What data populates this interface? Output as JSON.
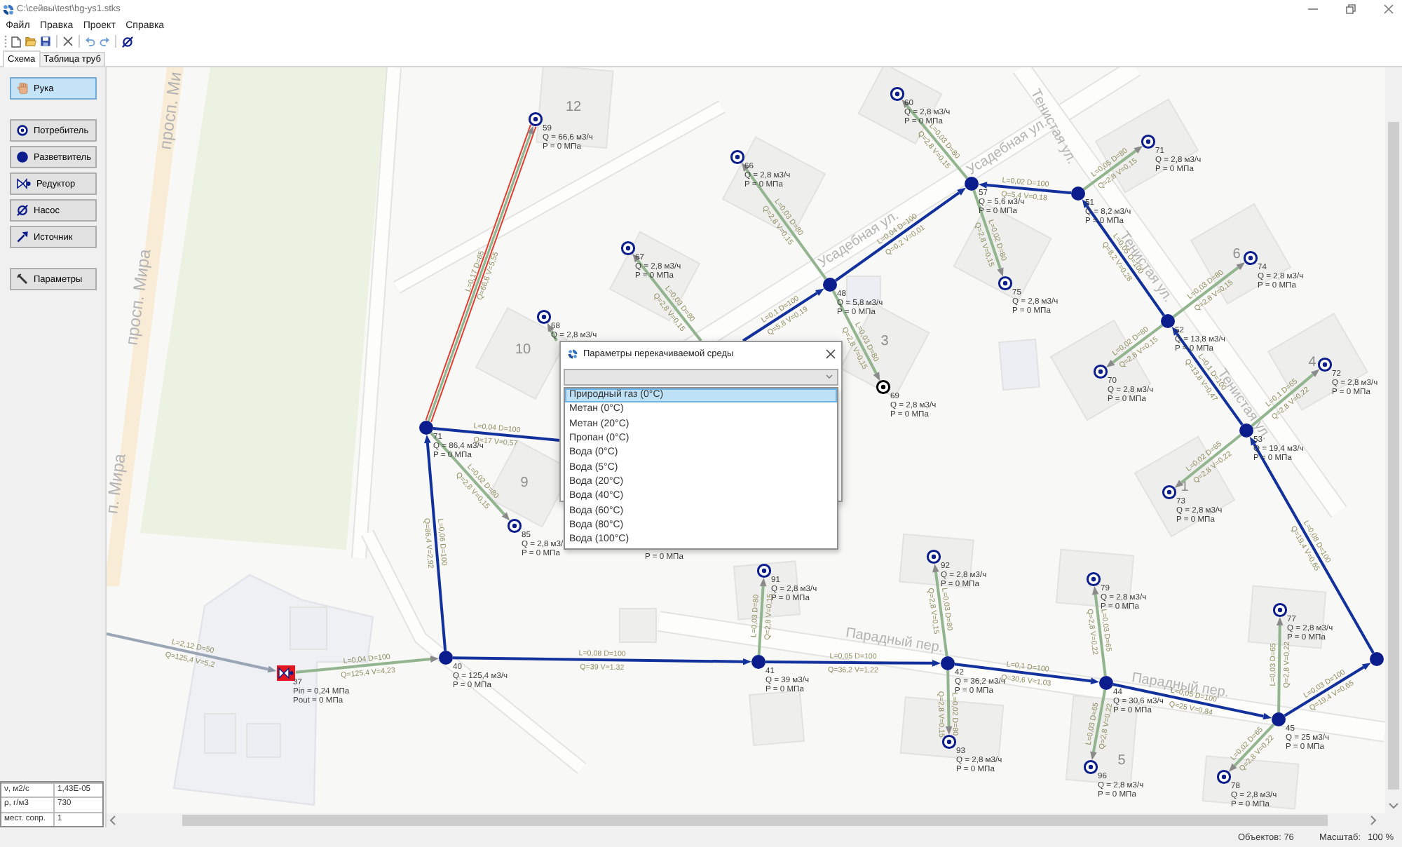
{
  "window": {
    "title": "C:\\сейвы\\test\\bg-ys1.stks"
  },
  "menu": [
    {
      "label": "Файл"
    },
    {
      "label": "Правка"
    },
    {
      "label": "Проект"
    },
    {
      "label": "Справка"
    }
  ],
  "tabs": [
    {
      "label": "Схема",
      "selected": true
    },
    {
      "label": "Таблица труб",
      "selected": false
    }
  ],
  "toolbox": {
    "groups": [
      {
        "tools": [
          {
            "kind": "hand",
            "label": "Рука",
            "selected": true
          }
        ]
      },
      {
        "tools": [
          {
            "kind": "consumer",
            "label": "Потребитель",
            "selected": false
          },
          {
            "kind": "splitter",
            "label": "Разветвитель",
            "selected": false
          },
          {
            "kind": "reducer",
            "label": "Редуктор",
            "selected": false
          },
          {
            "kind": "pump",
            "label": "Насос",
            "selected": false
          },
          {
            "kind": "source",
            "label": "Источник",
            "selected": false
          }
        ]
      },
      {
        "tools": [
          {
            "kind": "settings",
            "label": "Параметры",
            "selected": false
          }
        ]
      }
    ]
  },
  "properties": [
    {
      "name": "ν, м2/с",
      "value": "1,43E-05"
    },
    {
      "name": "ρ, г/м3",
      "value": "730"
    },
    {
      "name": "мест. сопр.",
      "value": "1"
    }
  ],
  "map": {
    "street_labels": [
      "просп. Ми",
      "просп. Мира",
      "п. Мира",
      "Усадебная ул.",
      "Усадебная ул.",
      "Тенистая ул.",
      "Тенистая ул.",
      "Тенистая ул.",
      "Парадный пер.",
      "Парадный пер."
    ],
    "building_numbers": [
      "12",
      "10",
      "9",
      "3",
      "6",
      "4",
      "1",
      "5"
    ],
    "pipes": [
      {
        "kind": "branch",
        "selected": false,
        "dimensions": "L=0,03 D=80",
        "flow": "Q=2,8 V=0,15"
      },
      {
        "kind": "branch",
        "selected": false,
        "dimensions": "L=0,05 D=80",
        "flow": "Q=2,8 V=0,15"
      },
      {
        "kind": "main",
        "selected": false,
        "dimensions": "L=0,02 D=100",
        "flow": "Q=5,4 V=0,18"
      },
      {
        "kind": "branch",
        "selected": false,
        "dimensions": "L=0,03 D=80",
        "flow": "Q=2,8 V=0,15"
      },
      {
        "kind": "main",
        "selected": false,
        "dimensions": "L=0,04 D=100",
        "flow": "Q=0,2 V=0,01"
      },
      {
        "kind": "branch",
        "selected": false,
        "dimensions": "L=0,02 D=80",
        "flow": "Q=2,8 V=0,15"
      },
      {
        "kind": "main",
        "selected": false,
        "dimensions": "L=0,05 D=100",
        "flow": "Q=8,2 V=0,28"
      },
      {
        "kind": "branch",
        "selected": true,
        "dimensions": "L=0,17 D=65",
        "flow": "Q=66,6 V=5,55"
      },
      {
        "kind": "branch",
        "selected": false,
        "dimensions": "L=0,03 D=80",
        "flow": "Q=2,8 V=0,15"
      },
      {
        "kind": "branch",
        "selected": false,
        "dimensions": "L=0,03 D=80",
        "flow": "Q=2,8 V=0,15"
      },
      {
        "kind": "main",
        "selected": false,
        "dimensions": "L=0,1 D=100",
        "flow": "Q=5,8 V=0,19"
      },
      {
        "kind": "branch",
        "selected": false
      },
      {
        "kind": "branch",
        "selected": false,
        "dimensions": "L=0,03 D=80",
        "flow": "Q=2,8 V=0,15"
      },
      {
        "kind": "branch",
        "selected": false,
        "dimensions": "L=0,02 D=80",
        "flow": "Q=2,8 V=0,15"
      },
      {
        "kind": "main",
        "selected": false,
        "dimensions": "L=0,1 D=100",
        "flow": "Q=13,8 V=0,47"
      },
      {
        "kind": "branch",
        "selected": false,
        "dimensions": "L=0,1 D=65",
        "flow": "Q=2,8 V=0,22"
      },
      {
        "kind": "main",
        "selected": false,
        "dimensions": "L=0,04 D=100",
        "flow": "Q=17 V=0,57"
      },
      {
        "kind": "branch",
        "selected": false,
        "dimensions": "L=0,02 D=65",
        "flow": "Q=2,8 V=0,22"
      },
      {
        "kind": "branch",
        "selected": false,
        "dimensions": "L=0,02 D=80",
        "flow": "Q=2,8 V=0,15"
      },
      {
        "kind": "main",
        "selected": false,
        "dimensions": "L=0,06 D=100",
        "flow": "Q=86,4 V=2,92"
      },
      {
        "kind": "main",
        "selected": false,
        "dimensions": "L=0,08 D=100",
        "flow": "Q=19,4 V=0,65"
      },
      {
        "kind": "branch",
        "selected": false,
        "dimensions": "L=0,03 D=80",
        "flow": "Q=2,8 V=0,15"
      },
      {
        "kind": "branch",
        "selected": false,
        "dimensions": "L=0,03 D=80",
        "flow": "Q=2,8 V=0,15"
      },
      {
        "kind": "branch",
        "selected": false,
        "dimensions": "L=0,03 D=65",
        "flow": "Q=2,8 V=0,22"
      },
      {
        "kind": "supply",
        "selected": false,
        "dimensions": "L=2,12 D=50",
        "flow": "Q=125,4 V=5,2"
      },
      {
        "kind": "branch",
        "selected": false,
        "dimensions": "L=0,04 D=100",
        "flow": "Q=125,4 V=4,23"
      },
      {
        "kind": "main",
        "selected": false,
        "dimensions": "L=0,08 D=100",
        "flow": "Q=39 V=1,32"
      },
      {
        "kind": "main",
        "selected": false,
        "dimensions": "L=0,05 D=100",
        "flow": "Q=36,2 V=1,22"
      },
      {
        "kind": "main",
        "selected": false,
        "dimensions": "L=0,1 D=100",
        "flow": "Q=30,6 V=1,03"
      },
      {
        "kind": "branch",
        "selected": false,
        "dimensions": "L=0,03 D=65",
        "flow": "Q=2,8 V=0,22"
      },
      {
        "kind": "main",
        "selected": false,
        "dimensions": "L=0,03 D=100",
        "flow": "Q=19,4 V=0,65"
      },
      {
        "kind": "branch",
        "selected": false,
        "dimensions": "L=0,02 D=80",
        "flow": "Q=2,8 V=0,15"
      },
      {
        "kind": "main",
        "selected": false,
        "dimensions": "L=0,05 D=100",
        "flow": "Q=25 V=0,84"
      },
      {
        "kind": "branch",
        "selected": false,
        "dimensions": "L=0,03 D=65",
        "flow": "Q=2,8 V=0,22"
      },
      {
        "kind": "branch",
        "selected": false,
        "dimensions": "L=0,02 D=65",
        "flow": "Q=2,8 V=0,22"
      }
    ],
    "nodes": [
      {
        "kind": "consumer",
        "label": "60",
        "lines": [
          "Q = 2,8 м3/ч",
          "P = 0 МПа"
        ],
        "color": "#0b1c8c"
      },
      {
        "kind": "consumer",
        "label": "59",
        "lines": [
          "Q = 66,6 м3/ч",
          "P = 0 МПа"
        ],
        "color": "#0b1c8c"
      },
      {
        "kind": "consumer",
        "label": "71",
        "lines": [
          "Q = 2,8 м3/ч",
          "P = 0 МПа"
        ],
        "color": "#0b1c8c"
      },
      {
        "kind": "consumer",
        "label": "66",
        "lines": [
          "Q = 2,8 м3/ч",
          "P = 0 МПа"
        ],
        "color": "#0b1c8c"
      },
      {
        "kind": "junction",
        "label": "57",
        "lines": [
          "Q = 5,6 м3/ч",
          "P = 0 МПа"
        ],
        "color": "#0b1c8c"
      },
      {
        "kind": "junction",
        "label": "51",
        "lines": [
          "Q = 8,2 м3/ч",
          "P = 0 МПа"
        ],
        "color": "#0b1c8c"
      },
      {
        "kind": "consumer",
        "label": "67",
        "lines": [
          "Q = 2,8 м3/ч",
          "P = 0 МПа"
        ],
        "color": "#0b1c8c"
      },
      {
        "kind": "consumer",
        "label": "74",
        "lines": [
          "Q = 2,8 м3/ч",
          "P = 0 МПа"
        ],
        "color": "#0b1c8c"
      },
      {
        "kind": "junction",
        "label": "48",
        "lines": [
          "Q = 5,8 м3/ч",
          "P = 0 МПа"
        ],
        "color": "#0b1c8c"
      },
      {
        "kind": "consumer",
        "label": "75",
        "lines": [
          "Q = 2,8 м3/ч",
          "P = 0 МПа"
        ],
        "color": "#0b1c8c"
      },
      {
        "kind": "consumer",
        "label": "68",
        "lines": [
          "Q = 2,8 м3/ч"
        ],
        "color": "#0b1c8c"
      },
      {
        "kind": "junction",
        "label": "52",
        "lines": [
          "Q = 13,8 м3/ч",
          "P = 0 МПа"
        ],
        "color": "#0b1c8c"
      },
      {
        "kind": "consumer",
        "label": "69",
        "lines": [
          "Q = 2,8 м3/ч",
          "P = 0 МПа"
        ],
        "color": "#000000"
      },
      {
        "kind": "consumer",
        "label": "70",
        "lines": [
          "Q = 2,8 м3/ч",
          "P = 0 МПа"
        ],
        "color": "#0b1c8c"
      },
      {
        "kind": "consumer",
        "label": "72",
        "lines": [
          "Q = 2,8 м3/ч",
          "P = 0 МПа"
        ],
        "color": "#0b1c8c"
      },
      {
        "kind": "junction",
        "label": "71",
        "lines": [
          "Q = 86,4 м3/ч",
          "P = 0 МПа"
        ],
        "color": "#0b1c8c"
      },
      {
        "kind": "junction",
        "label": "53",
        "lines": [
          "Q = 19,4 м3/ч",
          "P = 0 МПа"
        ],
        "color": "#0b1c8c"
      },
      {
        "kind": "consumer",
        "label": "73",
        "lines": [
          "Q = 2,8 м3/ч",
          "P = 0 МПа"
        ],
        "color": "#0b1c8c"
      },
      {
        "kind": "consumer",
        "label": "85",
        "lines": [
          "Q = 2,8 м3/",
          "P = 0 МПа"
        ],
        "color": "#0b1c8c"
      },
      {
        "kind": "covered",
        "lines": [
          "P = 0 МПа"
        ]
      },
      {
        "kind": "consumer",
        "label": "91",
        "lines": [
          "Q = 2,8 м3/ч",
          "P = 0 МПа"
        ],
        "color": "#0b1c8c"
      },
      {
        "kind": "consumer",
        "label": "92",
        "lines": [
          "Q = 2,8 м3/ч",
          "P = 0 МПа"
        ],
        "color": "#0b1c8c"
      },
      {
        "kind": "consumer",
        "label": "79",
        "lines": [
          "Q = 2,8 м3/ч",
          "P = 0 МПа"
        ],
        "color": "#0b1c8c"
      },
      {
        "kind": "consumer",
        "label": "77",
        "lines": [
          "Q = 2,8 м3/ч",
          "P = 0 МПа"
        ],
        "color": "#0b1c8c"
      },
      {
        "kind": "reducer",
        "label": "37",
        "lines": [
          "Pin = 0,24 МПа",
          "Pout = 0 МПа"
        ],
        "color": "#e3161d"
      },
      {
        "kind": "junction",
        "label": "40",
        "lines": [
          "Q = 125,4 м3/ч",
          "P = 0 МПа"
        ],
        "color": "#0b1c8c"
      },
      {
        "kind": "junction",
        "label": "41",
        "lines": [
          "Q = 39 м3/ч",
          "P = 0 МПа"
        ],
        "color": "#0b1c8c"
      },
      {
        "kind": "junction",
        "label": "42",
        "lines": [
          "Q = 36,2 м3/ч",
          "P = 0 МПа"
        ],
        "color": "#0b1c8c"
      },
      {
        "kind": "junction",
        "color": "#0b1c8c"
      },
      {
        "kind": "junction",
        "label": "44",
        "lines": [
          "Q = 30,6 м3/ч",
          "P = 0 МПа"
        ],
        "color": "#0b1c8c"
      },
      {
        "kind": "junction",
        "label": "45",
        "lines": [
          "Q = 25 м3/ч",
          "P = 0 МПа"
        ],
        "color": "#0b1c8c"
      },
      {
        "kind": "consumer",
        "label": "93",
        "lines": [
          "Q = 2,8 м3/ч",
          "P = 0 МПа"
        ],
        "color": "#0b1c8c"
      },
      {
        "kind": "consumer",
        "label": "96",
        "lines": [
          "Q = 2,8 м3/ч",
          "P = 0 МПа"
        ],
        "color": "#0b1c8c"
      },
      {
        "kind": "consumer",
        "label": "78",
        "lines": [
          "Q = 2,8 м3/ч",
          "P = 0 МПа"
        ],
        "color": "#0b1c8c"
      }
    ]
  },
  "dialog": {
    "title": "Параметры перекачиваемой среды",
    "options": [
      {
        "label": "Природный газ (0°C)",
        "selected": true
      },
      {
        "label": "Метан (0°C)",
        "selected": false
      },
      {
        "label": "Метан (20°C)",
        "selected": false
      },
      {
        "label": "Пропан (0°C)",
        "selected": false
      },
      {
        "label": "Вода (0°C)",
        "selected": false
      },
      {
        "label": "Вода (5°C)",
        "selected": false
      },
      {
        "label": "Вода (20°C)",
        "selected": false
      },
      {
        "label": "Вода (40°C)",
        "selected": false
      },
      {
        "label": "Вода (60°C)",
        "selected": false
      },
      {
        "label": "Вода (80°C)",
        "selected": false
      },
      {
        "label": "Вода (100°C)",
        "selected": false
      }
    ]
  },
  "status_bar": {
    "objects": "Объектов: 76",
    "scale_label": "Масштаб:",
    "scale": "100 %"
  }
}
